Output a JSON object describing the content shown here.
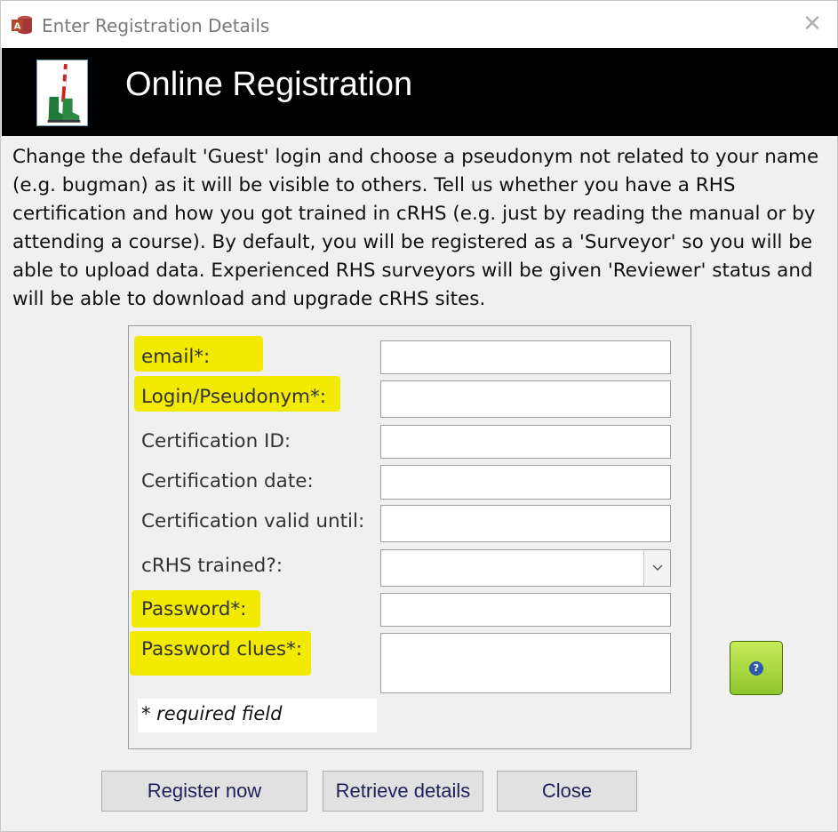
{
  "window": {
    "title": "Enter Registration Details",
    "close_glyph": "✕"
  },
  "banner": {
    "title": "Online Registration"
  },
  "intro": "Change the default 'Guest' login and choose a pseudonym not related to your name (e.g. bugman) as it will be visible to others. Tell us whether you have a RHS certification and how you got trained in cRHS (e.g. just by reading the manual or by attending a course). By default, you will be registered as a 'Surveyor' so you will be able to upload data. Experienced RHS surveyors will be given 'Reviewer' status and will be able to download and upgrade cRHS sites.",
  "form": {
    "email_label": "email*:",
    "login_label": "Login/Pseudonym*:",
    "cert_id_label": "Certification ID:",
    "cert_date_label": "Certification date:",
    "cert_valid_label": "Certification valid until:",
    "crhs_trained_label": "cRHS trained?:",
    "password_label": "Password*:",
    "password_clues_label": "Password clues*:",
    "email_value": "",
    "login_value": "",
    "cert_id_value": "",
    "cert_date_value": "",
    "cert_valid_value": "",
    "crhs_trained_value": "",
    "password_value": "",
    "password_clues_value": "",
    "required_note": "* required field"
  },
  "buttons": {
    "register": "Register now",
    "retrieve": "Retrieve details",
    "close": "Close",
    "help_glyph": "?"
  },
  "colors": {
    "highlight": "#f2ea00",
    "banner_bg": "#000000",
    "help_button": "#a6d83c"
  }
}
